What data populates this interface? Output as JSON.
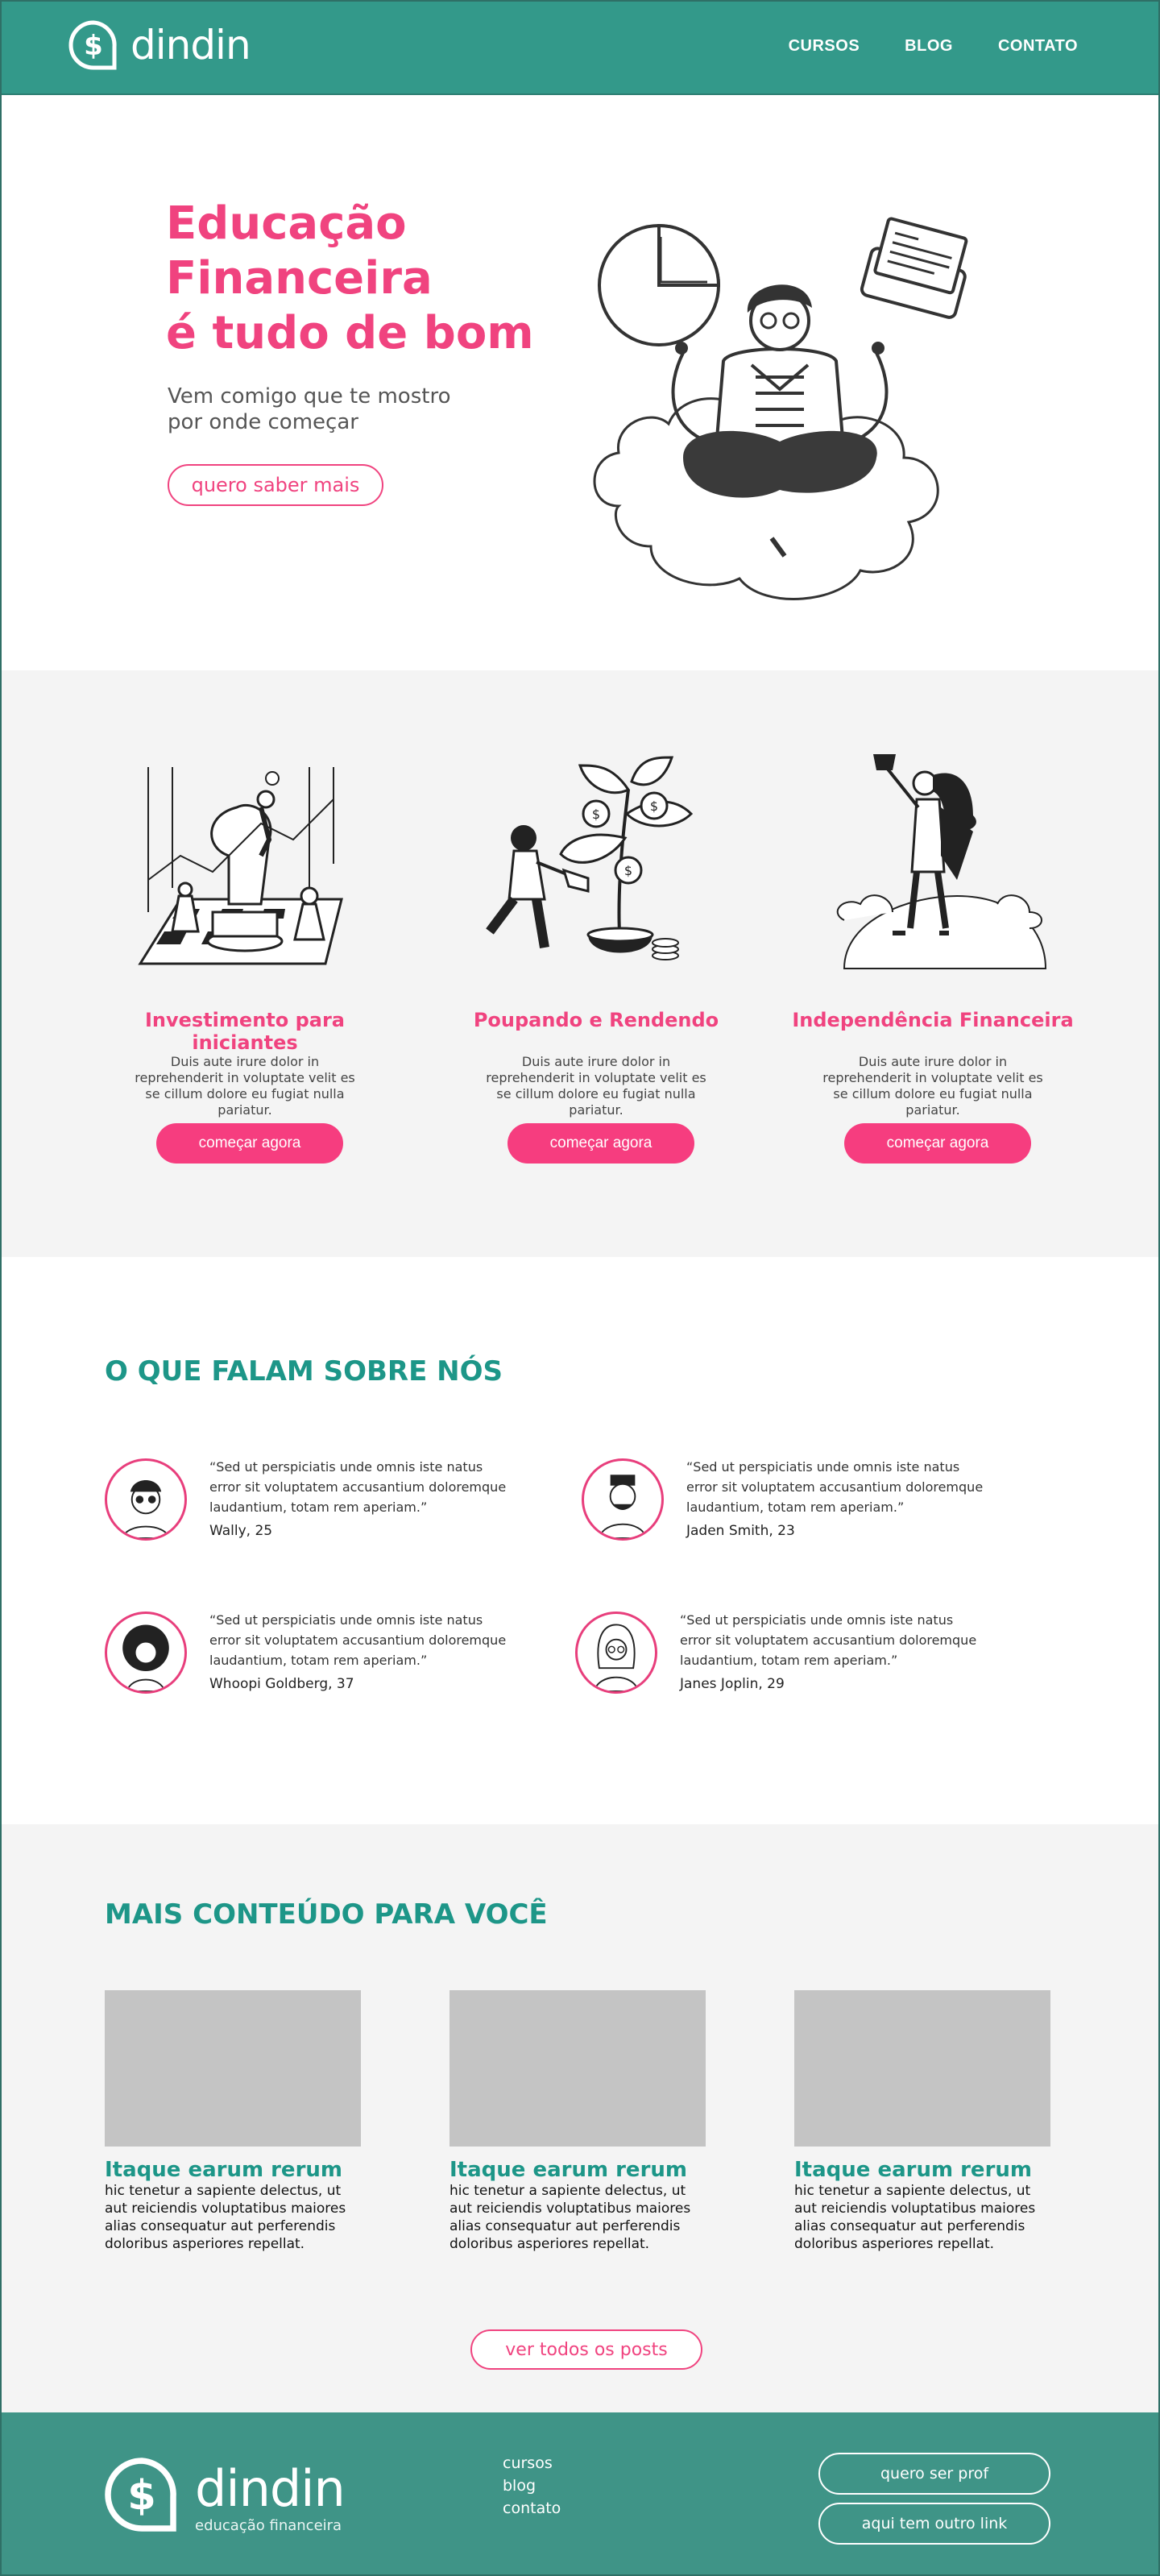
{
  "header": {
    "brand": "dindin",
    "nav": [
      "CURSOS",
      "BLOG",
      "CONTATO"
    ]
  },
  "hero": {
    "title_lines": [
      "Educação",
      "Financeira",
      "é tudo de bom"
    ],
    "subtitle_lines": [
      "Vem comigo que te mostro",
      "por onde começar"
    ],
    "cta": "quero saber mais"
  },
  "features": [
    {
      "title": "Investimento para iniciantes",
      "text": "Duis aute irure dolor in reprehenderit in voluptate velit es  se cillum dolore eu fugiat nulla pariatur.",
      "button": "começar agora",
      "icon": "chess-illustration"
    },
    {
      "title": "Poupando e Rendendo",
      "text": "Duis aute irure dolor in reprehenderit in voluptate velit es  se cillum dolore eu fugiat nulla pariatur.",
      "button": "começar agora",
      "icon": "money-plant-illustration"
    },
    {
      "title": "Independência Financeira",
      "text": "Duis aute irure dolor in reprehenderit in voluptate velit es  se cillum dolore eu fugiat nulla pariatur.",
      "button": "começar agora",
      "icon": "hero-trophy-illustration"
    }
  ],
  "testimonials": {
    "title": "O QUE FALAM SOBRE NÓS",
    "items": [
      {
        "quote": "“Sed ut perspiciatis unde omnis iste natus error sit voluptatem accusantium doloremque laudantium, totam rem aperiam.”",
        "author": "Wally, 25"
      },
      {
        "quote": "“Sed ut perspiciatis unde omnis iste natus error sit voluptatem accusantium doloremque laudantium, totam rem aperiam.”",
        "author": "Jaden Smith, 23"
      },
      {
        "quote": "“Sed ut perspiciatis unde omnis iste natus error sit voluptatem accusantium doloremque laudantium, totam rem aperiam.”",
        "author": "Whoopi Goldberg, 37"
      },
      {
        "quote": "“Sed ut perspiciatis unde omnis iste natus error sit voluptatem accusantium doloremque laudantium, totam rem aperiam.”",
        "author": "Janes Joplin, 29"
      }
    ]
  },
  "more": {
    "title": "MAIS CONTEÚDO PARA VOCÊ",
    "cards": [
      {
        "title": "Itaque earum rerum",
        "text": "hic tenetur a sapiente delectus, ut aut reiciendis voluptatibus maiores alias consequatur aut perferendis doloribus asperiores repellat."
      },
      {
        "title": "Itaque earum rerum",
        "text": "hic tenetur a sapiente delectus, ut aut reiciendis voluptatibus maiores alias consequatur aut perferendis doloribus asperiores repellat."
      },
      {
        "title": "Itaque earum rerum",
        "text": "hic tenetur a sapiente delectus, ut aut reiciendis voluptatibus maiores alias consequatur aut perferendis doloribus asperiores repellat."
      }
    ],
    "button": "ver todos os posts"
  },
  "footer": {
    "brand": "dindin",
    "tagline": "educação financeira",
    "links": [
      "cursos",
      "blog",
      "contato"
    ],
    "buttons": [
      "quero ser prof",
      "aqui tem outro link"
    ]
  },
  "colors": {
    "teal": "#33998a",
    "pink": "#f0437f",
    "footer": "#3f9487",
    "section_bg": "#f4f4f4"
  }
}
